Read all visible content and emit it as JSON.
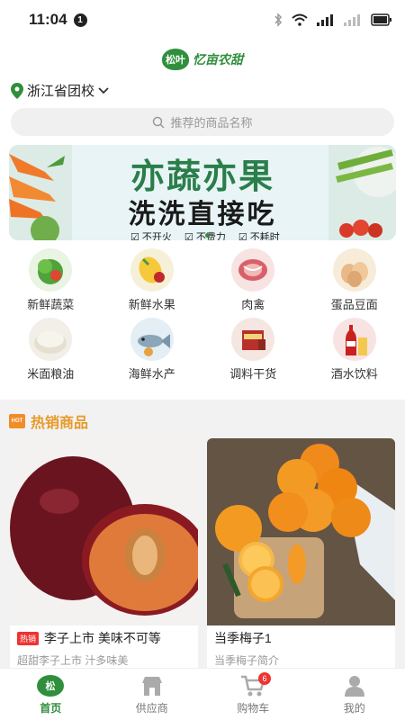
{
  "status_bar": {
    "time": "11:04",
    "notification_count": "1"
  },
  "header": {
    "logo_mark": "松叶",
    "logo_text": "忆亩农甜",
    "location": "浙江省团校",
    "search_placeholder": "推荐的商品名称"
  },
  "banner": {
    "title": "亦蔬亦果",
    "subtitle": "洗洗直接吃",
    "tags": [
      "不开火",
      "不费力",
      "不耗时"
    ]
  },
  "categories": [
    {
      "label": "新鲜蔬菜",
      "icon": "vegetable-icon",
      "color": "#e9f4e3"
    },
    {
      "label": "新鲜水果",
      "icon": "fruit-icon",
      "color": "#f6f0d8"
    },
    {
      "label": "肉禽",
      "icon": "meat-icon",
      "color": "#f8e3e3"
    },
    {
      "label": "蛋品豆面",
      "icon": "egg-icon",
      "color": "#f7ecd9"
    },
    {
      "label": "米面粮油",
      "icon": "rice-icon",
      "color": "#f1efe8"
    },
    {
      "label": "海鲜水产",
      "icon": "seafood-icon",
      "color": "#e4eef5"
    },
    {
      "label": "调料干货",
      "icon": "seasoning-icon",
      "color": "#f5e6e2"
    },
    {
      "label": "酒水饮料",
      "icon": "drink-icon",
      "color": "#f8e3e3"
    }
  ],
  "hot_section": {
    "title": "热销商品",
    "badge": "HOT"
  },
  "products": [
    {
      "tag": "热销",
      "name": "李子上市 美味不可等",
      "desc": "超甜李子上市 汁多味美"
    },
    {
      "tag": "",
      "name": "当季梅子1",
      "desc": "当季梅子简介"
    }
  ],
  "tabbar": {
    "items": [
      {
        "label": "首页",
        "icon": "home-logo-icon"
      },
      {
        "label": "供应商",
        "icon": "store-icon"
      },
      {
        "label": "购物车",
        "icon": "cart-icon",
        "badge": "6"
      },
      {
        "label": "我的",
        "icon": "user-icon"
      }
    ]
  },
  "colors": {
    "brand": "#2f8f3c",
    "hot": "#e89a2a",
    "badge_red": "#e33333"
  }
}
